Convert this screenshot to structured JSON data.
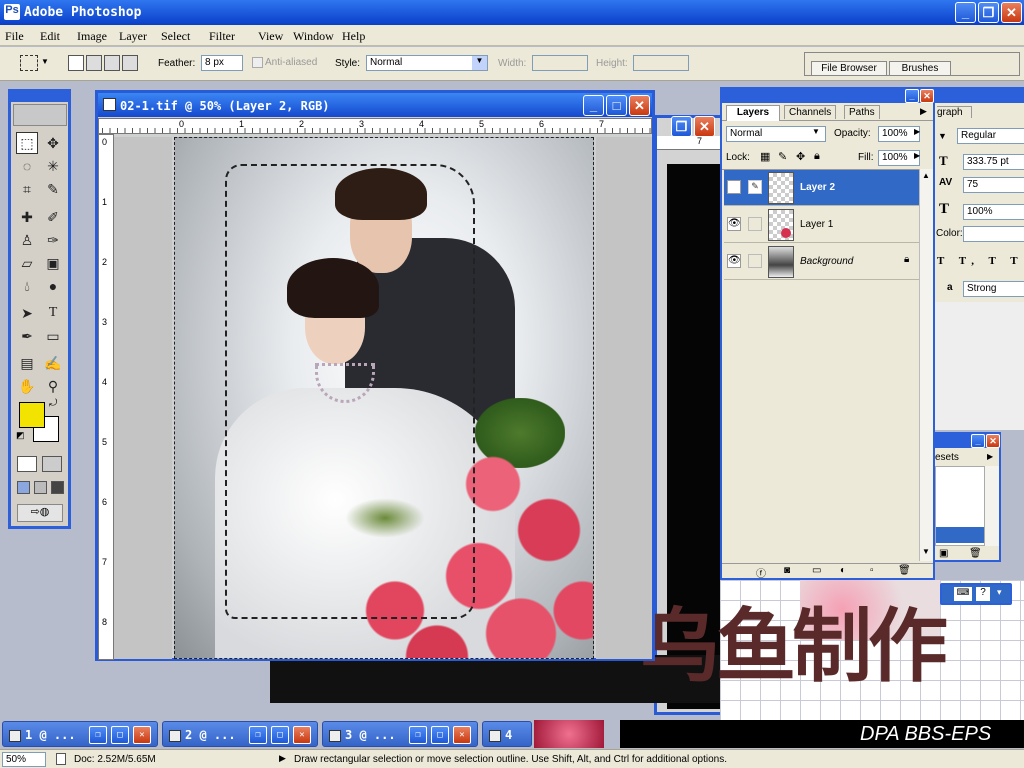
{
  "app": {
    "title": "Adobe Photoshop"
  },
  "menu": [
    "File",
    "Edit",
    "Image",
    "Layer",
    "Select",
    "Filter",
    "View",
    "Window",
    "Help"
  ],
  "options": {
    "feather_label": "Feather:",
    "feather_value": "8 px",
    "antialiased_label": "Anti-aliased",
    "style_label": "Style:",
    "style_value": "Normal",
    "width_label": "Width:",
    "height_label": "Height:"
  },
  "well_tabs": [
    "File Browser",
    "Brushes"
  ],
  "document": {
    "title": "02-1.tif @ 50% (Layer 2, RGB)",
    "ruler_top": [
      "0",
      "1",
      "2",
      "3",
      "4",
      "5",
      "6",
      "7"
    ],
    "ruler_left": [
      "0",
      "1",
      "2",
      "3",
      "4",
      "5",
      "6",
      "7",
      "8"
    ]
  },
  "back_document": {
    "ruler_top": [
      "7"
    ],
    "overlay_text": "乌鱼制作",
    "banner_text": "DPA BBS-EPS"
  },
  "layers_panel": {
    "tabs": [
      "Layers",
      "Channels",
      "Paths"
    ],
    "blend_mode": "Normal",
    "opacity_label": "Opacity:",
    "opacity_value": "100%",
    "lock_label": "Lock:",
    "fill_label": "Fill:",
    "fill_value": "100%",
    "layers": [
      {
        "name": "Layer 2",
        "selected": true
      },
      {
        "name": "Layer 1",
        "selected": false
      },
      {
        "name": "Background",
        "selected": false
      }
    ]
  },
  "character_panel": {
    "tab": "graph",
    "font_style": "Regular",
    "size": "333.75 pt",
    "tracking": "75",
    "scale": "100%",
    "color_label": "Color:",
    "antialias": "Strong"
  },
  "presets_panel": {
    "tab": "esets"
  },
  "taskbar": [
    {
      "label": "1 @ ..."
    },
    {
      "label": "2 @ ..."
    },
    {
      "label": "3 @ ..."
    },
    {
      "label": "4"
    }
  ],
  "status": {
    "zoom": "50%",
    "doc": "Doc: 2.52M/5.65M",
    "hint": "Draw rectangular selection or move selection outline.  Use Shift, Alt, and Ctrl for additional options."
  },
  "colors": {
    "foreground": "#f2e400",
    "background": "#ffffff",
    "titlebar": "#1f5bd8",
    "selected_layer": "#3169c6"
  }
}
